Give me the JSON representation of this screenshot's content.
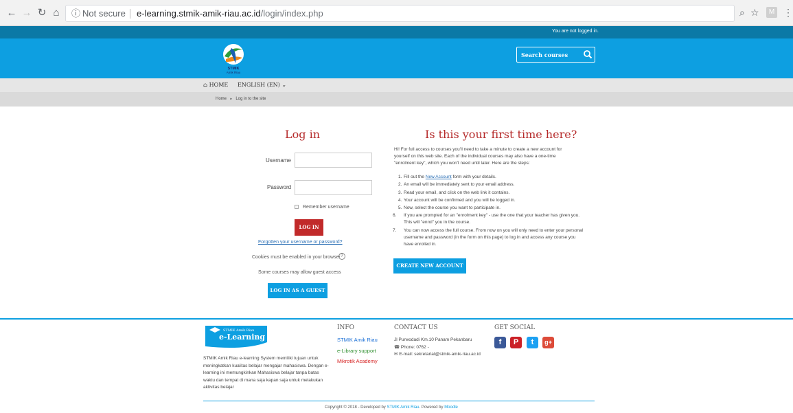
{
  "browser": {
    "security_label": "Not secure",
    "url_host": "e-learning.stmik-amik-riau.ac.id",
    "url_path": "/login/index.php",
    "profile_initial": "M"
  },
  "topbar": {
    "login_status": "You are not logged in."
  },
  "header": {
    "logo_text_1": "STMIK",
    "logo_text_2": "Amik Riau",
    "search_placeholder": "Search courses"
  },
  "nav": {
    "home": "HOME",
    "language": "ENGLISH (EN)"
  },
  "breadcrumb": {
    "home": "Home",
    "separator": "►",
    "current": "Log in to the site"
  },
  "login": {
    "title": "Log in",
    "username_label": "Username",
    "password_label": "Password",
    "remember_label": "Remember username",
    "login_button": "LOG IN",
    "forgot_link": "Forgotten your username or password?",
    "cookies_note": "Cookies must be enabled in your browser",
    "guest_note": "Some courses may allow guest access",
    "guest_button": "LOG IN AS A GUEST"
  },
  "first_time": {
    "title": "Is this your first time here?",
    "intro": "Hi! For full access to courses you'll need to take a minute to create a new account for yourself on this web site. Each of the individual courses may also have a one-time \"enrolment key\", which you won't need until later. Here are the steps:",
    "steps": [
      {
        "num": "1.",
        "pre": "Fill out the ",
        "link": "New Account",
        "post": " form with your details."
      },
      {
        "num": "2.",
        "text": "An email will be immediately sent to your email address."
      },
      {
        "num": "3.",
        "text": "Read your email, and click on the web link it contains."
      },
      {
        "num": "4.",
        "text": "Your account will be confirmed and you will be logged in."
      },
      {
        "num": "5.",
        "text": "Now, select the course you want to participate in."
      },
      {
        "num": "6.",
        "text": "If you are prompted for an \"enrolment key\" - use the one that your teacher has given you. This will \"enrol\" you in the course."
      },
      {
        "num": "7.",
        "text": "You can now access the full course. From now on you will only need to enter your personal username and password (in the form on this page) to log in and access any course you have enrolled in."
      }
    ],
    "create_button": "CREATE NEW ACCOUNT"
  },
  "footer": {
    "logo_small": "STMIK Amik Riau",
    "logo_big": "e-Learning",
    "description": "STMIK Amik Riau e-learning System memiliki tujuan untuk meningkatkan kualitas belajar mengajar mahasiswa. Dengan e-learning ini memungkinkan Mahasiswa belajar tanpa batas waktu dan tempat di mana saja kapan saja untuk melakukan aktivitas belajar",
    "info_heading": "INFO",
    "info_links": [
      {
        "label": "STMIK Amik Riau",
        "color": "#1a6fd6"
      },
      {
        "label": "e-Library support",
        "color": "#2f8f2f"
      },
      {
        "label": "Mikrotik Academy",
        "color": "#d62020"
      }
    ],
    "contact_heading": "CONTACT US",
    "address": "Jl Purwodadi Km.10 Panam Pekanbaru",
    "phone": "Phone: 0762 -",
    "email": "E-mail: sekretariat@stmik-amik-riau.ac.id",
    "social_heading": "GET SOCIAL",
    "social": [
      {
        "name": "facebook",
        "glyph": "f",
        "color": "#3b5998"
      },
      {
        "name": "pinterest",
        "glyph": "P",
        "color": "#cb2027"
      },
      {
        "name": "twitter",
        "glyph": "t",
        "color": "#1da1f2"
      },
      {
        "name": "google-plus",
        "glyph": "g+",
        "color": "#dd4b39"
      }
    ],
    "copyright_pre": "Copyright © 2018 - Developed by ",
    "copyright_link1": "STMIK Amik Riau",
    "copyright_mid": ". Powered by ",
    "copyright_link2": "Moodle"
  }
}
